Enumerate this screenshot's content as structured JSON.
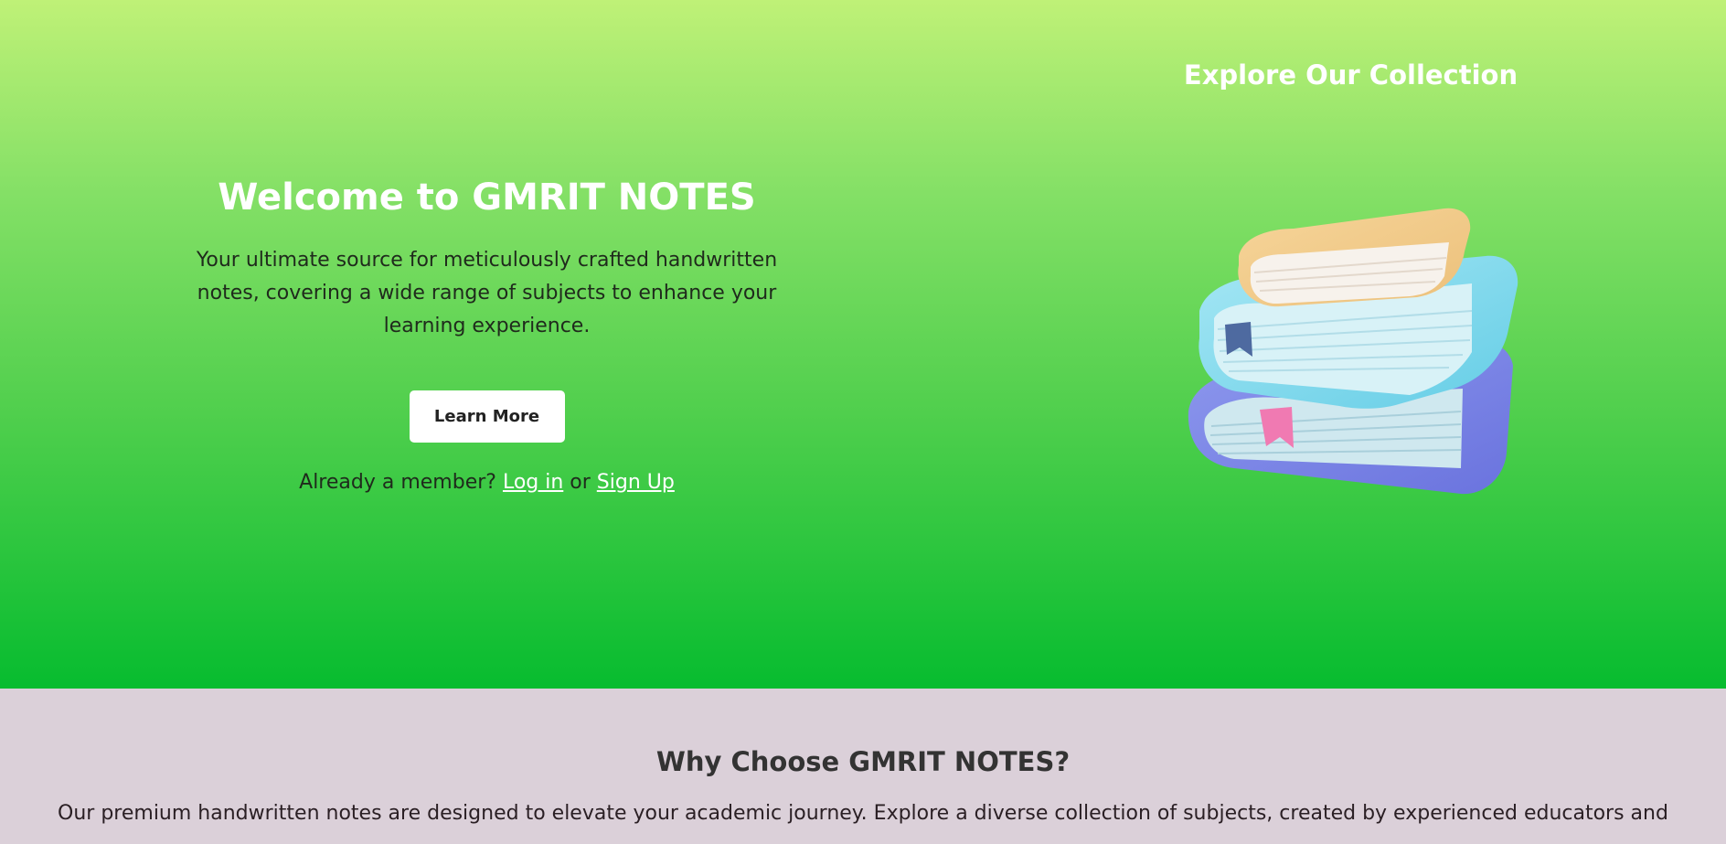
{
  "hero": {
    "title": "Welcome to GMRIT NOTES",
    "description": "Your ultimate source for meticulously crafted handwritten notes, covering a wide range of subjects to enhance your learning experience.",
    "learn_more_label": "Learn More",
    "member_prefix": "Already a member? ",
    "login_label": "Log in",
    "or_text": " or ",
    "signup_label": "Sign Up"
  },
  "collection": {
    "title": "Explore Our Collection",
    "image_icon": "stacked-books-illustration"
  },
  "why": {
    "title": "Why Choose GMRIT NOTES?",
    "text": "Our premium handwritten notes are designed to elevate your academic journey. Explore a diverse collection of subjects, created by experienced educators and"
  },
  "colors": {
    "hero_gradient_top": "#bff177",
    "hero_gradient_bottom": "#07bc2f",
    "why_background": "#dbd0d9"
  }
}
